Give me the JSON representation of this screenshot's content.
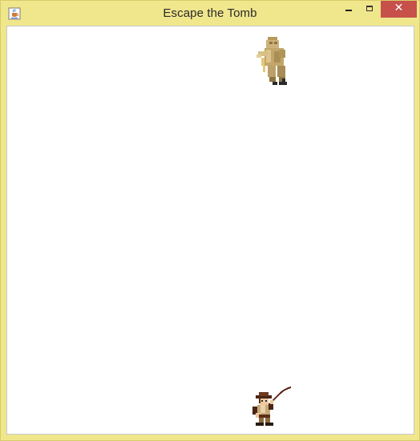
{
  "window": {
    "title": "Escape the Tomb",
    "icon": "java-cup-icon",
    "frame_color": "#f0e68c",
    "close_button_color": "#c7504b",
    "buttons": {
      "minimize": "minimize-icon",
      "maximize": "maximize-icon",
      "close": "close-icon"
    }
  },
  "game": {
    "background": "#ffffff",
    "sprites": [
      {
        "name": "mummy",
        "icon": "mummy-enemy-sprite"
      },
      {
        "name": "explorer",
        "icon": "explorer-with-whip-sprite"
      }
    ]
  }
}
